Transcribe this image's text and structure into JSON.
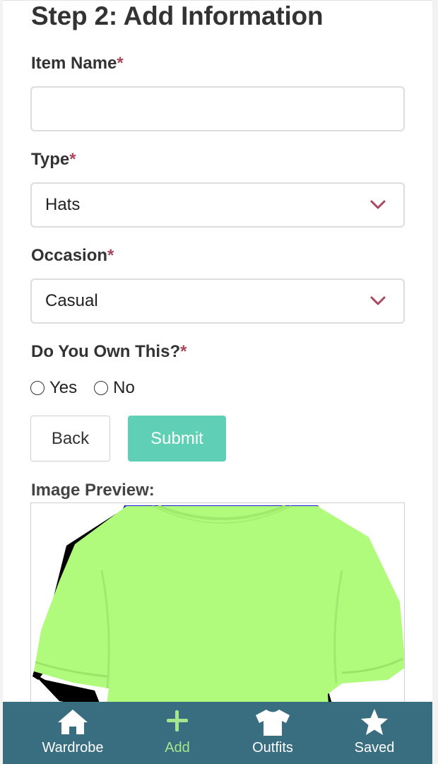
{
  "form": {
    "title": "Step 2: Add Information",
    "item_name": {
      "label": "Item Name",
      "required_mark": "*",
      "value": "",
      "placeholder": ""
    },
    "type": {
      "label": "Type",
      "required_mark": "*",
      "selected": "Hats"
    },
    "occasion": {
      "label": "Occasion",
      "required_mark": "*",
      "selected": "Casual"
    },
    "own": {
      "label": "Do You Own This?",
      "required_mark": "*",
      "options": [
        {
          "label": "Yes",
          "checked": false
        },
        {
          "label": "No",
          "checked": false
        }
      ]
    },
    "back_label": "Back",
    "submit_label": "Submit",
    "preview_label": "Image Preview:"
  },
  "preview": {
    "subject": "t-shirt-image",
    "shirt_color": "#b0fb7c"
  },
  "nav": {
    "items": [
      {
        "label": "Wardrobe",
        "icon": "home-icon"
      },
      {
        "label": "Add",
        "icon": "plus-icon"
      },
      {
        "label": "Outfits",
        "icon": "tshirt-icon"
      },
      {
        "label": "Saved",
        "icon": "star-icon"
      }
    ]
  },
  "colors": {
    "accent": "#5fcfb6",
    "required": "#a8475e",
    "nav_bg": "#386e80",
    "nav_active": "#a6e58f"
  }
}
